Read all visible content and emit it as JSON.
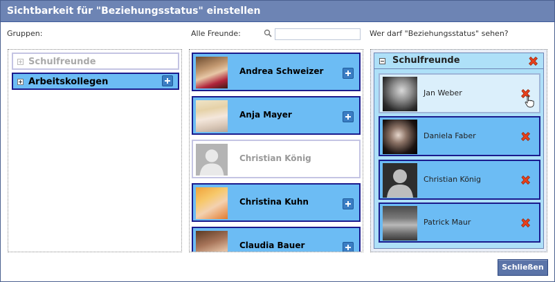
{
  "dialog": {
    "title": "Sichtbarkeit für \"Beziehungsstatus\" einstellen"
  },
  "labels": {
    "groups": "Gruppen:",
    "all_friends": "Alle Freunde:",
    "who_can_see": "Wer darf \"Beziehungsstatus\" sehen?"
  },
  "search": {
    "value": "",
    "placeholder": ""
  },
  "groups": [
    {
      "label": "Schulfreunde",
      "state": "disabled"
    },
    {
      "label": "Arbeitskollegen",
      "state": "active"
    }
  ],
  "friends": [
    {
      "name": "Andrea Schweizer",
      "state": "active"
    },
    {
      "name": "Anja Mayer",
      "state": "active"
    },
    {
      "name": "Christian König",
      "state": "disabled"
    },
    {
      "name": "Christina Kuhn",
      "state": "active"
    },
    {
      "name": "Claudia Bauer",
      "state": "active"
    }
  ],
  "visible_group": {
    "title": "Schulfreunde",
    "members": [
      {
        "name": "Jan Weber",
        "state": "hover"
      },
      {
        "name": "Daniela Faber",
        "state": "normal"
      },
      {
        "name": "Christian König",
        "state": "normal"
      },
      {
        "name": "Patrick Maur",
        "state": "normal"
      }
    ]
  },
  "footer": {
    "close_label": "Schließen"
  },
  "colors": {
    "titlebar": "#6d84b4",
    "item_active": "#6cbcf4",
    "item_border": "#1a1a8c",
    "group_header": "#aee0f8",
    "button": "#5b74a8",
    "remove_icon": "#e8401c"
  },
  "icons": {
    "search": "search-icon",
    "add": "plus-icon",
    "remove": "x-icon",
    "expand": "plus-square-icon",
    "collapse": "minus-square-icon",
    "cursor": "hand-pointer-icon"
  }
}
